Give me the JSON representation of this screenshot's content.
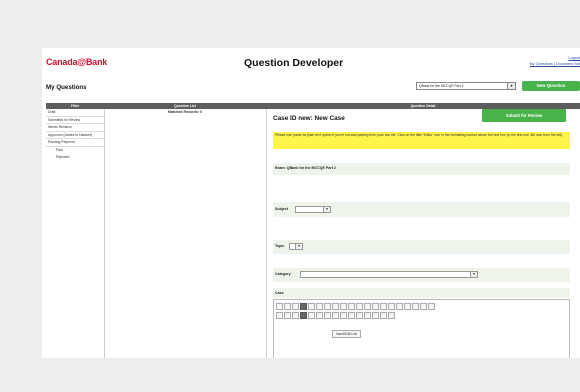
{
  "header": {
    "logo_text": "Canada@Bank",
    "app_title": "Question Developer",
    "links": [
      "Logout",
      "My Questions | Document Set"
    ]
  },
  "section_title": "My Questions",
  "question_set_select": "QBank for the MCCQE Part 2",
  "new_question_label": "New Question",
  "columns": [
    "Filter",
    "Question List",
    "Question Detail"
  ],
  "filters": [
    {
      "label": "Draft"
    },
    {
      "label": "Submitted for Review"
    },
    {
      "label": "Needs Revision"
    },
    {
      "label": "Approved (Added to Dataset)"
    },
    {
      "label": "Pending Payment"
    },
    {
      "label": "Paid",
      "sub": true
    },
    {
      "label": "Rejected",
      "sub": true
    }
  ],
  "matched_records": "Matched Records: 0",
  "detail": {
    "case_title": "Case ID new: New Case",
    "submit_label": "Submit for Review",
    "notice": "Please use 'paste as plain text' option if you're cut-and-pasting from your doc file. Click on the little 'Editor' icon in the formatting toolbar above the text box (in the first row, 4th icon from the left).",
    "exam_label": "Exam: QBank for the MCCQE Part 2",
    "subject_label": "Subject",
    "topic_label": "Topic",
    "category_label": "Category",
    "case_label": "Case",
    "tooltip": "Insert/Edit Link"
  }
}
